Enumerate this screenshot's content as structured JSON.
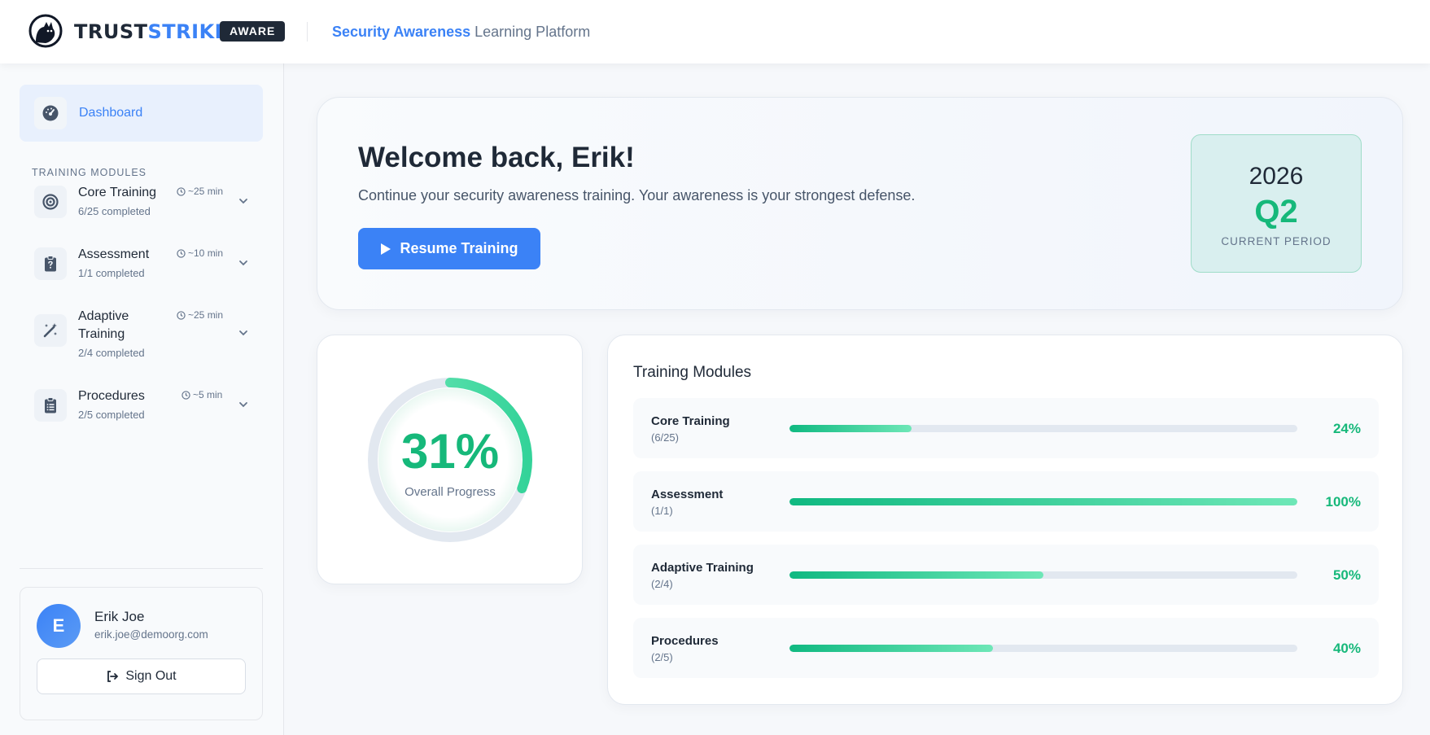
{
  "header": {
    "brand_part1": "TRUST",
    "brand_part2": "STRIKE",
    "badge": "AWARE",
    "title_highlight": "Security Awareness",
    "title_rest": "Learning Platform"
  },
  "sidebar": {
    "dashboard_label": "Dashboard",
    "section_title": "TRAINING MODULES",
    "modules": [
      {
        "title": "Core Training",
        "time": "~25 min",
        "progress": "6/25 completed",
        "icon": "target-icon"
      },
      {
        "title": "Assessment",
        "time": "~10 min",
        "progress": "1/1 completed",
        "icon": "clipboard-question-icon"
      },
      {
        "title": "Adaptive Training",
        "time": "~25 min",
        "progress": "2/4 completed",
        "icon": "magic-wand-icon"
      },
      {
        "title": "Procedures",
        "time": "~5 min",
        "progress": "2/5 completed",
        "icon": "clipboard-list-icon"
      }
    ],
    "user": {
      "initial": "E",
      "name": "Erik Joe",
      "email": "erik.joe@demoorg.com",
      "signout_label": "Sign Out"
    }
  },
  "hero": {
    "title": "Welcome back, Erik!",
    "subtitle": "Continue your security awareness training. Your awareness is your strongest defense.",
    "button_label": "Resume Training",
    "period_year": "2026",
    "period_quarter": "Q2",
    "period_label": "CURRENT PERIOD"
  },
  "overall": {
    "percent_label": "31%",
    "percent_value": 31,
    "label": "Overall Progress"
  },
  "training_modules": {
    "title": "Training Modules",
    "rows": [
      {
        "name": "Core Training",
        "count": "(6/25)",
        "percent_label": "24%",
        "percent": 24
      },
      {
        "name": "Assessment",
        "count": "(1/1)",
        "percent_label": "100%",
        "percent": 100
      },
      {
        "name": "Adaptive Training",
        "count": "(2/4)",
        "percent_label": "50%",
        "percent": 50
      },
      {
        "name": "Procedures",
        "count": "(2/5)",
        "percent_label": "40%",
        "percent": 40
      }
    ]
  },
  "colors": {
    "accent_blue": "#3b82f6",
    "accent_green": "#16b87a",
    "dark": "#1f2937"
  }
}
